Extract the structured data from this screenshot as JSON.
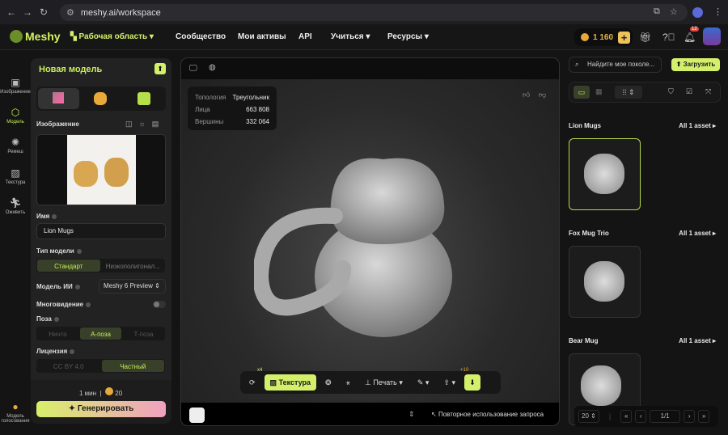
{
  "browser": {
    "url": "meshy.ai/workspace"
  },
  "header": {
    "logo": "Meshy",
    "workspace": "Рабочая область",
    "nav": [
      "Сообщество",
      "Мои активы",
      "API",
      "Учиться",
      "Ресурсы"
    ],
    "credits": "1 160",
    "notifications": "12"
  },
  "rail": {
    "items": [
      {
        "label": "Изображение"
      },
      {
        "label": "Модель"
      },
      {
        "label": "Ремеш"
      },
      {
        "label": "Текстура"
      },
      {
        "label": "Оживить"
      }
    ],
    "vote": "Модель голосования"
  },
  "panel": {
    "title": "Новая модель",
    "image_label": "Изображение",
    "name_label": "Имя",
    "name_value": "Lion Mugs",
    "type_label": "Тип модели",
    "type_options": [
      "Стандарт",
      "Низкополигонал..."
    ],
    "ai_label": "Модель ИИ",
    "ai_value": "Meshy 6 Preview",
    "multi_label": "Многовидение",
    "pose_label": "Поза",
    "pose_options": [
      "Ничто",
      "A-поза",
      "T-поза"
    ],
    "license_label": "Лицензия",
    "license_options": [
      "CC BY 4.0",
      "Частный"
    ],
    "time": "1 мин",
    "cost": "20",
    "generate": "Генерировать"
  },
  "viewport": {
    "stats": {
      "topology_label": "Топология",
      "topology": "Треугольник",
      "faces_label": "Лица",
      "faces": "663 808",
      "verts_label": "Вершины",
      "verts": "332 064"
    },
    "toolbar": {
      "remesh_badge": "x4",
      "texture": "Текстура",
      "print": "Печать",
      "share_badge": "+10"
    },
    "reuse": "Повторное использование запроса"
  },
  "right": {
    "search_placeholder": "Найдите мое поколе...",
    "upload": "Загрузить",
    "groups": [
      {
        "title": "Lion Mugs",
        "count": "All 1 asset"
      },
      {
        "title": "Fox Mug Trio",
        "count": "All 1 asset"
      },
      {
        "title": "Bear Mug",
        "count": "All 1 asset"
      }
    ],
    "page_size": "20",
    "page": "1/1"
  },
  "colors": {
    "accent": "#d4f06b",
    "credits": "#e6b34a"
  }
}
